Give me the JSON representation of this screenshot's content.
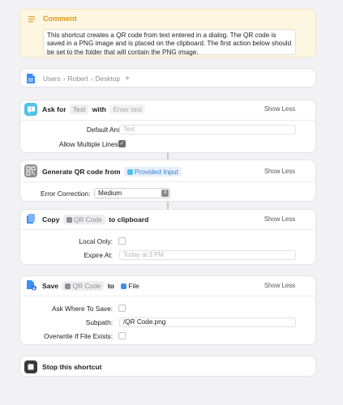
{
  "comment": {
    "title": "Comment",
    "text": "This shortcut creates a QR code from text entered in a dialog. The QR code is saved in a PNG image and is placed on the clipboard. The first action below should be set to the folder that will contain the PNG image."
  },
  "folder": {
    "path": [
      "Users",
      "Robert",
      "Desktop"
    ],
    "plus": "+"
  },
  "ask": {
    "label_ask": "Ask for",
    "token_type": "Text",
    "label_with": "with",
    "prompt_placeholder": "Enter text",
    "show_less": "Show Less",
    "default_answer_label": "Default Answer:",
    "default_answer_placeholder": "Text",
    "multi_lines_label": "Allow Multiple Lines:",
    "multi_lines_checked": true
  },
  "qr": {
    "title": "Generate QR code from",
    "token_input": "Provided Input",
    "show_less": "Show Less",
    "error_label": "Error Correction:",
    "error_value": "Medium"
  },
  "copy": {
    "label_copy": "Copy",
    "token": "QR Code",
    "label_to": "to clipboard",
    "show_less": "Show Less",
    "local_only_label": "Local Only:",
    "expire_label": "Expire At:",
    "expire_placeholder": "Today at 3 PM"
  },
  "save": {
    "label_save": "Save",
    "token": "QR Code",
    "label_to": "to",
    "token_file": "File",
    "show_less": "Show Less",
    "ask_where_label": "Ask Where To Save:",
    "subpath_label": "Subpath:",
    "subpath_value": "/QR Code.png",
    "overwrite_label": "Overwrite If File Exists:"
  },
  "stop": {
    "title": "Stop this shortcut"
  },
  "colors": {
    "comment_bg": "#fdf6e0",
    "comment_title": "#d49a1c",
    "accent_blue": "#3a7bd5",
    "ask_icon": "#4fc3e8",
    "copy_icon": "#3d8ef0",
    "qr_icon": "#8e8e93",
    "stop_icon": "#3a3a3c"
  }
}
